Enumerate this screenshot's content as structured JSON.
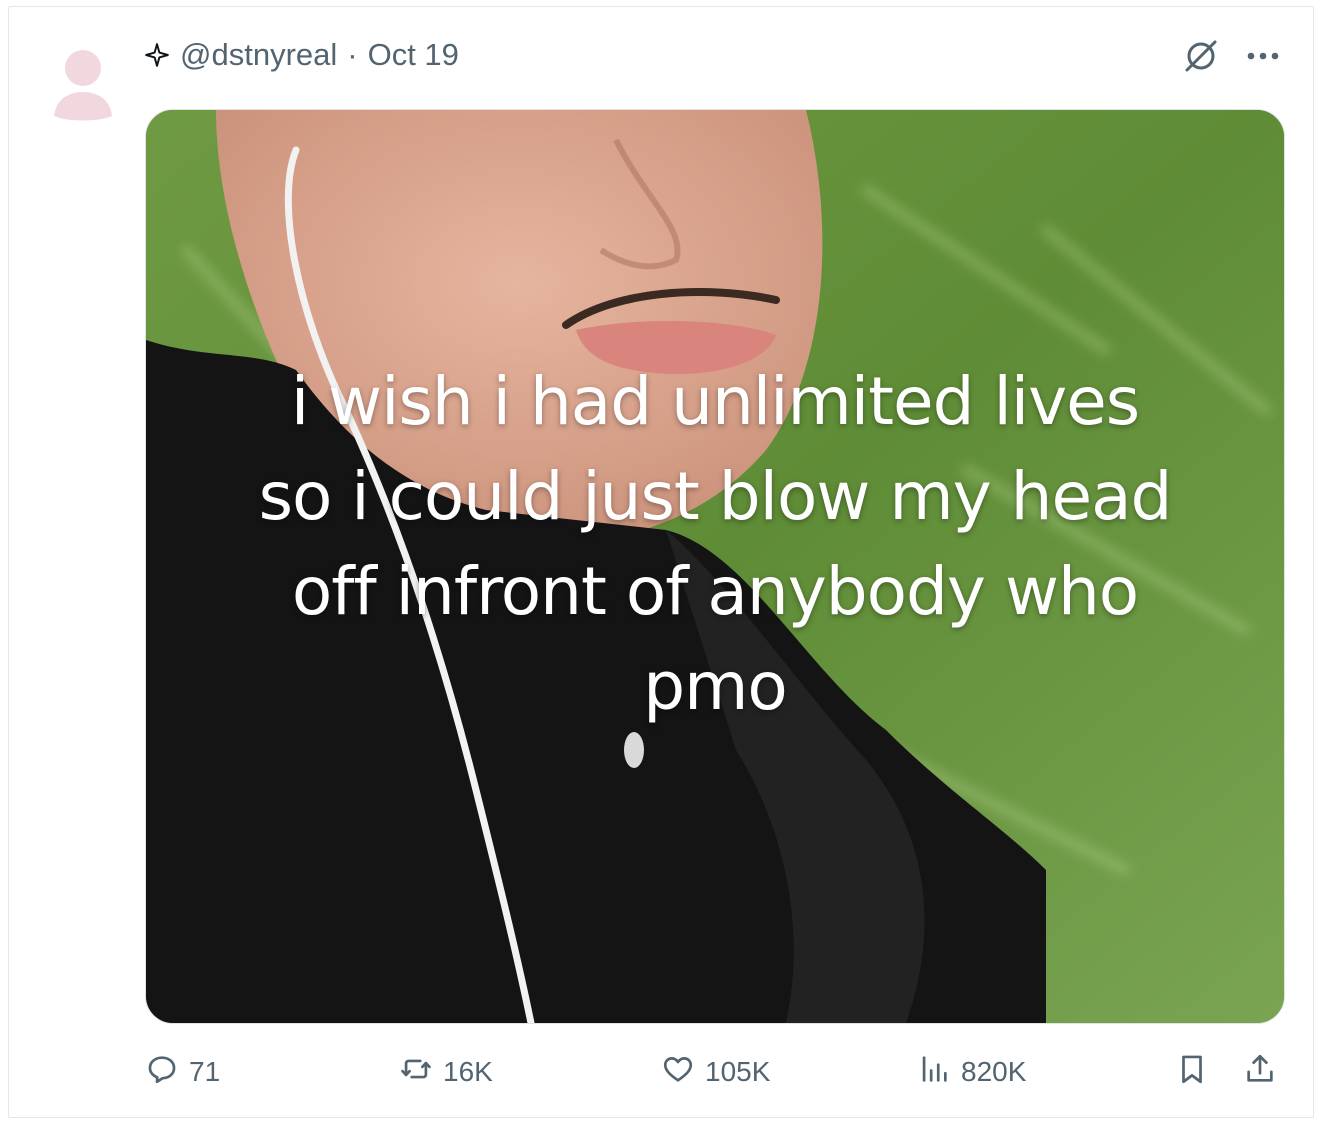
{
  "post": {
    "handle": "@dstnyreal",
    "separator": "·",
    "date": "Oct 19"
  },
  "media": {
    "caption_lines": [
      "i wish i had unlimited lives",
      "so i could just blow my head",
      "off infront of anybody who",
      "pmo"
    ]
  },
  "stats": {
    "replies": "71",
    "reposts": "16K",
    "likes": "105K",
    "views": "820K"
  },
  "icons": {
    "header": [
      "sparkle-icon",
      "grok-icon",
      "more-icon"
    ],
    "actions": [
      "reply-icon",
      "repost-icon",
      "like-icon",
      "views-icon",
      "bookmark-icon",
      "share-icon"
    ]
  },
  "colors": {
    "muted_text": "#536471",
    "avatar": "#f1d8df"
  }
}
